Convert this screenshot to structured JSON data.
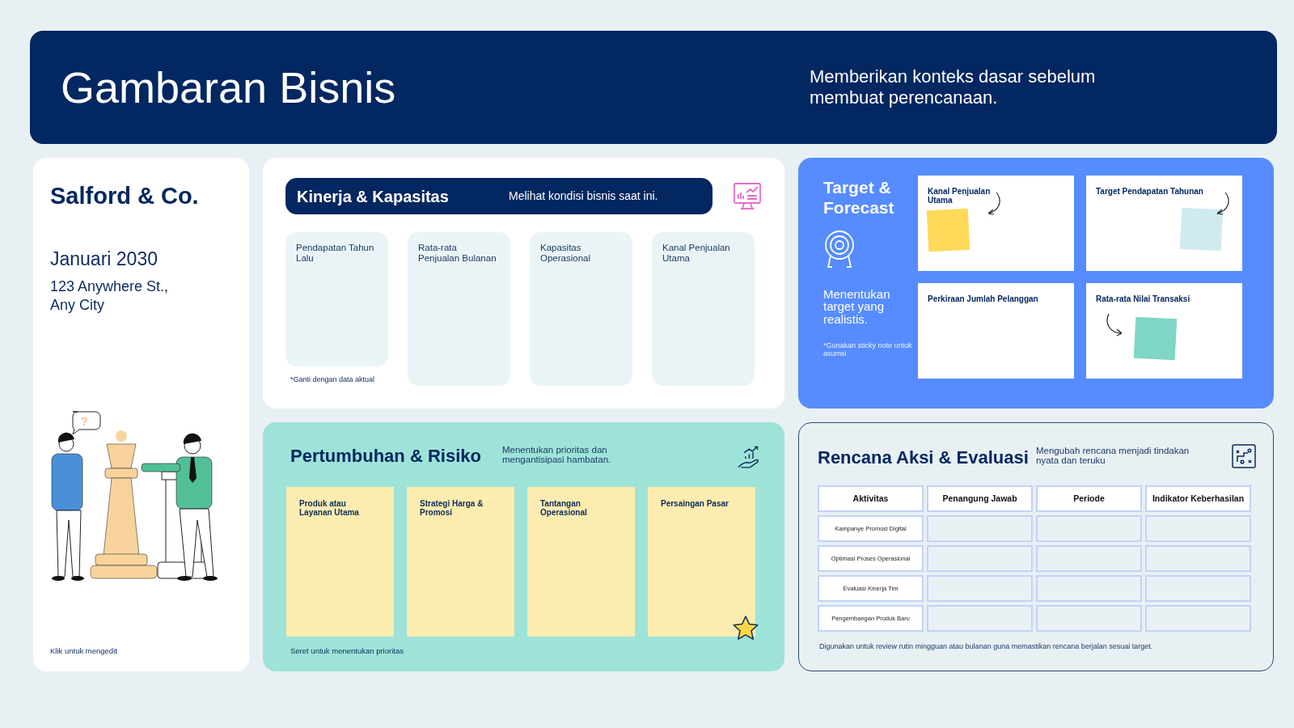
{
  "header": {
    "title": "Gambaran Bisnis",
    "subtitle": "Memberikan konteks dasar sebelum membuat perencanaan."
  },
  "company": {
    "name": "Salford & Co.",
    "date": "Januari 2030",
    "address_lines": [
      "123 Anywhere St.,",
      "Any City"
    ],
    "bubble": "?",
    "footer": "Klik untuk mengedit"
  },
  "kinerja": {
    "title": "Kinerja & Kapasitas",
    "description": "Melihat kondisi bisnis saat ini.",
    "metrics": [
      {
        "label": "Pendapatan Tahun Lalu"
      },
      {
        "label": "Rata-rata Penjualan Bulanan"
      },
      {
        "label": "Kapasitas Operasional"
      },
      {
        "label": "Kanal Penjualan Utama"
      }
    ],
    "note": "*Ganti dengan data aktual"
  },
  "target": {
    "title": "Target & Forecast",
    "description": "Menentukan target yang realistis.",
    "note": "*Gunakan sticky note untuk asumsi",
    "boxes": [
      {
        "label": "Kanal Penjualan Utama",
        "color": "#ffd95a"
      },
      {
        "label": "Target Pendapatan Tahunan",
        "color": "#d0ebf0"
      },
      {
        "label": "Perkiraan Jumlah Pelanggan"
      },
      {
        "label": "Rata-rata Nilai Transaksi",
        "color": "#7fd6c6"
      }
    ]
  },
  "growth": {
    "title": "Pertumbuhan & Risiko",
    "description": "Menentukan prioritas dan mengantisipasi hambatan.",
    "columns": [
      {
        "label": "Produk atau Layanan Utama"
      },
      {
        "label": "Strategi Harga & Promosi"
      },
      {
        "label": "Tantangan Operasional"
      },
      {
        "label": "Persaingan Pasar"
      }
    ],
    "note": "Seret untuk menentukan prioritas"
  },
  "plan": {
    "title": "Rencana Aksi & Evaluasi",
    "description": "Mengubah rencana menjadi tindakan nyata dan teruku",
    "table": {
      "columns": [
        "Aktivitas",
        "Penangung Jawab",
        "Periode",
        "Indikator Keberhasilan"
      ],
      "rows": [
        {
          "aktivitas": "Kampanye Promosi Digital"
        },
        {
          "aktivitas": "Optimasi Proses Operasional"
        },
        {
          "aktivitas": "Evaluasi Kinerja Tim"
        },
        {
          "aktivitas": "Pengembangan Produk Baru"
        }
      ]
    },
    "note": "Digunakan untuk review rutin mingguan atau bulanan guna memastikan rencana berjalan sesuai target."
  }
}
